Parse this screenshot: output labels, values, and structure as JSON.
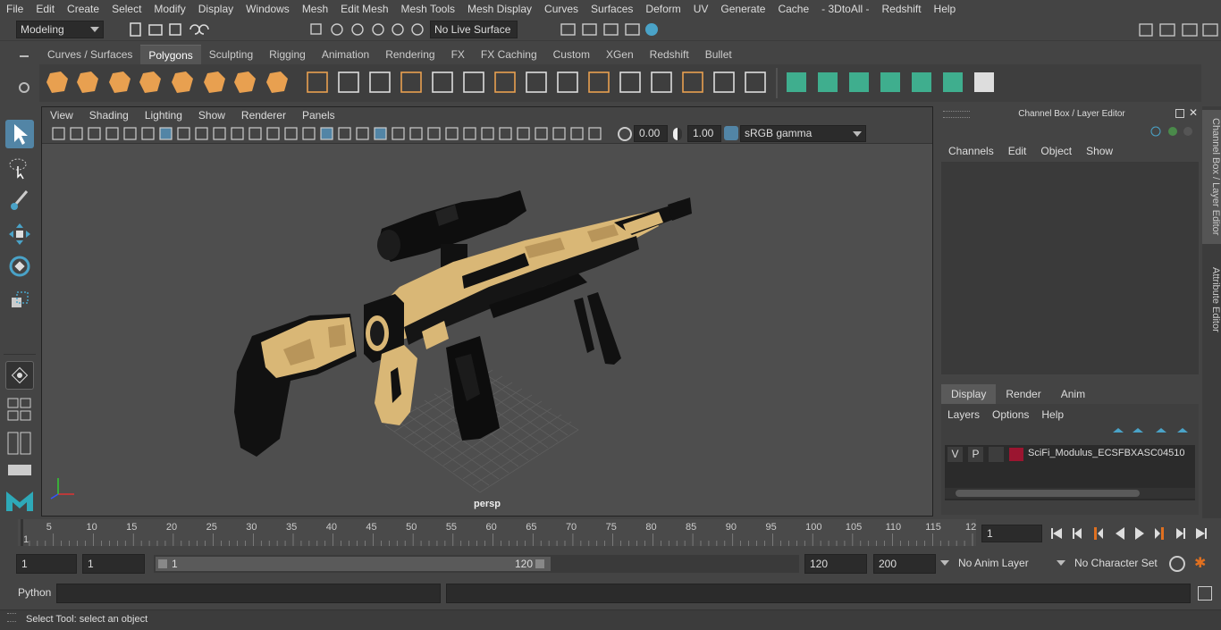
{
  "menubar": {
    "items": [
      "File",
      "Edit",
      "Create",
      "Select",
      "Modify",
      "Display",
      "Windows",
      "Mesh",
      "Edit Mesh",
      "Mesh Tools",
      "Mesh Display",
      "Curves",
      "Surfaces",
      "Deform",
      "UV",
      "Generate",
      "Cache",
      "- 3DtoAll -",
      "Redshift",
      "Help"
    ]
  },
  "statusline": {
    "mode": "Modeling",
    "live_surface": "No Live Surface"
  },
  "shelf": {
    "tabs": [
      "Curves / Surfaces",
      "Polygons",
      "Sculpting",
      "Rigging",
      "Animation",
      "Rendering",
      "FX",
      "FX Caching",
      "Custom",
      "XGen",
      "Redshift",
      "Bullet"
    ],
    "active_tab": "Polygons"
  },
  "viewport": {
    "menu": [
      "View",
      "Shading",
      "Lighting",
      "Show",
      "Renderer",
      "Panels"
    ],
    "exposure": "0.00",
    "gamma": "1.00",
    "color_space": "sRGB gamma",
    "camera_label": "persp"
  },
  "channelbox": {
    "title": "Channel Box / Layer Editor",
    "menu": [
      "Channels",
      "Edit",
      "Object",
      "Show"
    ],
    "layer_tabs": [
      "Display",
      "Render",
      "Anim"
    ],
    "active_layer_tab": "Display",
    "layer_menu": [
      "Layers",
      "Options",
      "Help"
    ],
    "layer": {
      "v": "V",
      "p": "P",
      "name": "SciFi_Modulus_ECSFBXASC04510",
      "color": "#9b1530"
    }
  },
  "sidetabs": [
    "Channel Box / Layer Editor",
    "Attribute Editor"
  ],
  "timeline": {
    "ticks": [
      "1",
      "5",
      "10",
      "15",
      "20",
      "25",
      "30",
      "35",
      "40",
      "45",
      "50",
      "55",
      "60",
      "65",
      "70",
      "75",
      "80",
      "85",
      "90",
      "95",
      "100",
      "105",
      "110",
      "115",
      "12"
    ],
    "current_frame": "1"
  },
  "range": {
    "start": "1",
    "inner_start": "1",
    "slider_start": "1",
    "slider_end": "120",
    "end": "120",
    "outer_end": "200",
    "anim_layer": "No Anim Layer",
    "char_set": "No Character Set"
  },
  "cmdline": {
    "label": "Python"
  },
  "helpline": {
    "text": "Select Tool: select an object"
  },
  "colors": {
    "accent": "#5285a6",
    "shelf_orange": "#e8a050",
    "shelf_teal": "#3fae8e"
  }
}
